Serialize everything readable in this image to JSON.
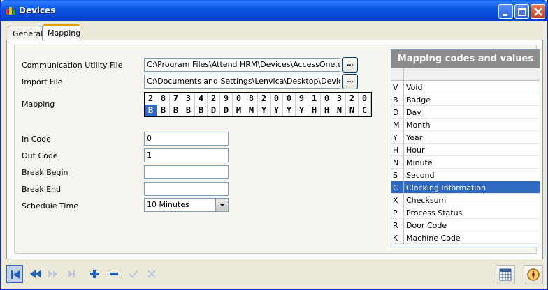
{
  "window": {
    "title": "Devices"
  },
  "tabs": [
    {
      "label": "General"
    },
    {
      "label": "Mapping"
    }
  ],
  "form": {
    "comm_utility": {
      "label": "Communication Utility File",
      "value": "C:\\Program Files\\Attend HRM\\Devices\\AccessOne.exe",
      "browse": "..."
    },
    "import_file": {
      "label": "Import File",
      "value": "C:\\Documents and Settings\\Lenvica\\Desktop\\Device\\Da",
      "browse": "..."
    },
    "mapping": {
      "label": "Mapping",
      "digits": [
        "2",
        "8",
        "7",
        "3",
        "4",
        "2",
        "9",
        "0",
        "8",
        "2",
        "0",
        "0",
        "9",
        "1",
        "0",
        "3",
        "2",
        "0"
      ],
      "codes": [
        "B",
        "B",
        "B",
        "B",
        "B",
        "D",
        "D",
        "M",
        "M",
        "Y",
        "Y",
        "Y",
        "Y",
        "H",
        "H",
        "N",
        "N",
        "C"
      ]
    },
    "in_code": {
      "label": "In Code",
      "value": "0"
    },
    "out_code": {
      "label": "Out Code",
      "value": "1"
    },
    "break_begin": {
      "label": "Break Begin",
      "value": ""
    },
    "break_end": {
      "label": "Break End",
      "value": ""
    },
    "schedule_time": {
      "label": "Schedule Time",
      "value": "10 Minutes"
    }
  },
  "codes_panel": {
    "title": "Mapping codes and values",
    "rows": [
      {
        "code": "V",
        "value": "Void"
      },
      {
        "code": "B",
        "value": "Badge"
      },
      {
        "code": "D",
        "value": "Day"
      },
      {
        "code": "M",
        "value": "Month"
      },
      {
        "code": "Y",
        "value": "Year"
      },
      {
        "code": "H",
        "value": "Hour"
      },
      {
        "code": "N",
        "value": "Minute"
      },
      {
        "code": "S",
        "value": "Second"
      },
      {
        "code": "C",
        "value": "Clocking Information"
      },
      {
        "code": "X",
        "value": "Checksum"
      },
      {
        "code": "P",
        "value": "Process Status"
      },
      {
        "code": "R",
        "value": "Door Code"
      },
      {
        "code": "K",
        "value": "Machine Code"
      }
    ],
    "selected_row": 8
  },
  "colors": {
    "selection": "#316ac5",
    "titlebar": "#0548d6",
    "nav_blue": "#1f5fbf"
  },
  "icons": {
    "toolbar": [
      "first-record-icon",
      "previous-record-icon",
      "next-record-icon",
      "last-record-icon",
      "add-icon",
      "remove-icon",
      "confirm-icon",
      "cancel-icon"
    ],
    "bottom_right": [
      "calendar-icon",
      "compass-icon"
    ]
  }
}
